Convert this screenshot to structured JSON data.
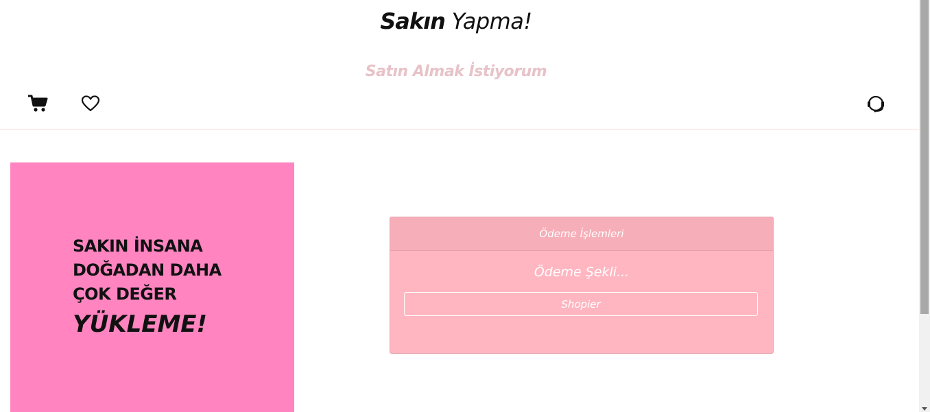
{
  "header": {
    "brand_strong": "Sakın",
    "brand_rest": "Yapma!",
    "tagline": "Satın Almak İstiyorum"
  },
  "nav": {
    "icons": [
      "shopping-cart-icon",
      "heart-icon",
      "headset-support-icon"
    ]
  },
  "promo": {
    "lines": [
      "SAKIN İNSANA",
      "DOĞADAN DAHA",
      "ÇOK DEĞER"
    ],
    "emphasis": "YÜKLEME!"
  },
  "payment": {
    "header": "Ödeme İşlemleri",
    "title": "Ödeme Şekli...",
    "button": "Shopier"
  },
  "colors": {
    "tagline": "#e7c3c8",
    "promo_bg": "#ff84c0",
    "card_bg": "#ffb6c1",
    "card_header": "#f6aeb8"
  }
}
